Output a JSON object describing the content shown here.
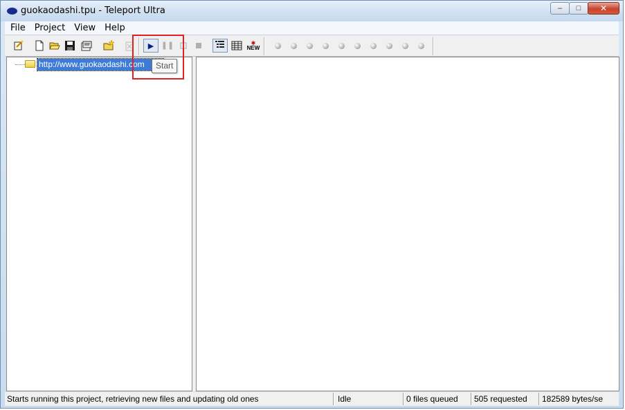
{
  "window": {
    "title": "guokaodashi.tpu - Teleport Ultra",
    "controls": {
      "minimize": "–",
      "maximize": "□",
      "close": "✕"
    }
  },
  "menu": [
    "File",
    "Project",
    "View",
    "Help"
  ],
  "toolbar": {
    "icons": [
      "new-project-wizard-icon",
      "new-file-icon",
      "open-folder-icon",
      "save-icon",
      "properties-icon",
      "new-folder-icon",
      "delete-icon",
      "start-icon",
      "pause-icon",
      "stop-icon",
      "stop-all-icon",
      "tree-view-icon",
      "details-view-icon",
      "new-badge-icon"
    ],
    "new_label": "NEW",
    "thread_count": 10
  },
  "tree": {
    "item": "http://www.guokaodashi.com"
  },
  "tooltip": {
    "text": "Start"
  },
  "status": {
    "message": "Starts running this project, retrieving new files and updating old ones",
    "state": "Idle",
    "queued": "0 files queued",
    "requested": "505 requested",
    "rate": "182589 bytes/se"
  }
}
